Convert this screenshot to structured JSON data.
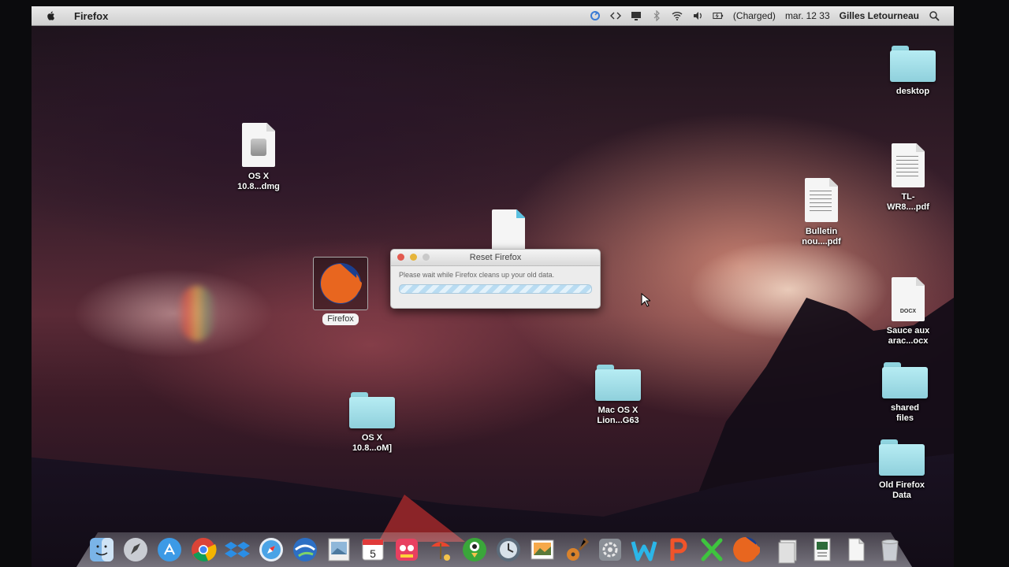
{
  "menubar": {
    "app_name": "Firefox",
    "status": "(Charged)",
    "clock": "mar. 12 33",
    "user": "Gilles Letourneau"
  },
  "desktop_icons": {
    "os_x_dmg": "OS X\n10.8...dmg",
    "firefox": "Firefox",
    "os_x_folder": "OS X\n10.8...oM]",
    "mac_os_x_lion": "Mac OS X\nLion...G63",
    "desktop": "desktop",
    "tl_pdf": "TL-\nWR8....pdf",
    "bulletin_pdf": "Bulletin\nnou....pdf",
    "sauce_docx": "Sauce aux\narac...ocx",
    "docx_tag": "DOCX",
    "shared_files": "shared\nfiles",
    "old_firefox_data": "Old Firefox\nData"
  },
  "dialog": {
    "title": "Reset Firefox",
    "message": "Please wait while Firefox cleans up your old data."
  },
  "dock": {
    "calendar_day": "5",
    "items": [
      "finder-icon",
      "launchpad-icon",
      "app-store-icon",
      "chrome-icon",
      "dropbox-icon",
      "safari-icon",
      "google-earth-icon",
      "preview-icon",
      "calendar-icon",
      "game-icon",
      "beach-icon",
      "parrot-icon",
      "time-machine-icon",
      "photo-icon",
      "guitar-icon",
      "settings-icon",
      "wps-writer-icon",
      "wps-presentation-icon",
      "wps-spreadsheet-icon",
      "firefox-icon",
      "documents-icon",
      "downloads-icon",
      "file-icon",
      "trash-icon"
    ]
  },
  "colors": {
    "folder": "#a8e2ec",
    "menubar": "#dcdcdc",
    "progress": "#b9dcf2"
  }
}
